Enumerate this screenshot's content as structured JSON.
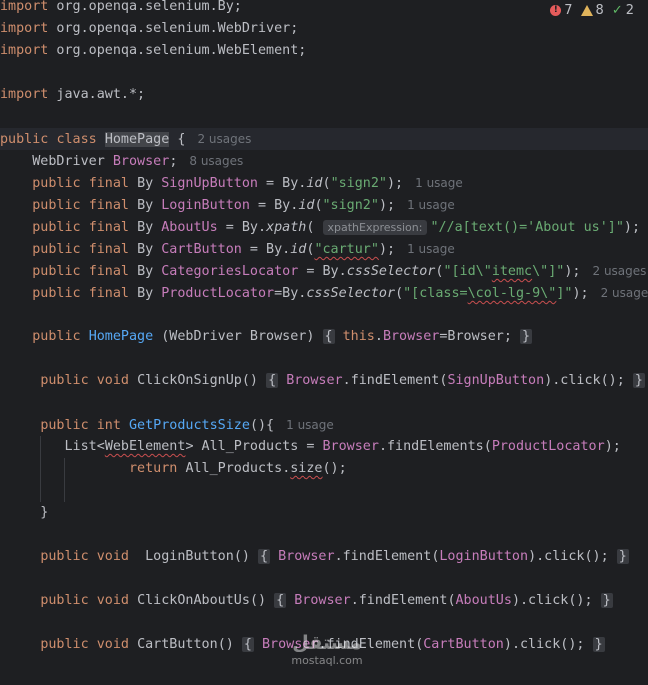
{
  "inspections": {
    "errors": "7",
    "warnings": "8",
    "ok": "2"
  },
  "code": {
    "import1": "import",
    "import1_path": " org.openqa.selenium.By;",
    "import2_path": " org.openqa.selenium.WebDriver;",
    "import3_path": " org.openqa.selenium.WebElement;",
    "import4_path": " java.awt.*;",
    "kw_public": "public",
    "kw_class": "class",
    "kw_final": "final",
    "kw_void": "void",
    "kw_int": "int",
    "kw_this": "this",
    "kw_return": "return",
    "class_name": "HomePage",
    "class_usages": "2 usages",
    "webdriver_type": "WebDriver",
    "browser_field": "Browser",
    "browser_usages": "8 usages",
    "by_type": "By",
    "signup_field": "SignUpButton",
    "signup_value": "\"sign2\"",
    "login_field": "LoginButton",
    "login_value": "\"sign2\"",
    "about_field": "AboutUs",
    "xpath_hint": "xpathExpression:",
    "about_value": "\"//a[text()='About us']\"",
    "cart_field": "CartButton",
    "cart_value": "\"cartur\"",
    "categories_field": "CategoriesLocator",
    "categories_value_a": "\"[id\\\"",
    "categories_value_b": "itemc",
    "categories_value_c": "\\\"]\"",
    "product_field": "ProductLocator",
    "product_value_a": "\"[class=",
    "product_value_b": "\\col-lg-9\\\"",
    "product_value_c": "]\"",
    "usage1": "1 usage",
    "usages2": "2 usages",
    "usage_edge": "1",
    "ctor_name": "HomePage",
    "ctor_params": " (WebDriver Browser) ",
    "m_signup": "ClickOnSignUp",
    "m_size": "GetProductsSize",
    "m_login": " LoginButton",
    "m_about": "ClickOnAboutUs",
    "m_cart": "CartButton",
    "list_type_a": "List<",
    "list_type_b": "WebElement",
    "list_type_c": "> All_Products = ",
    "find_element": "findElement",
    "find_elements": "findElements",
    "click_call": ".click();",
    "size_call": "size",
    "all_products": "All_Products"
  },
  "watermark": {
    "logo": "مستقل",
    "text": "mostaql.com"
  }
}
